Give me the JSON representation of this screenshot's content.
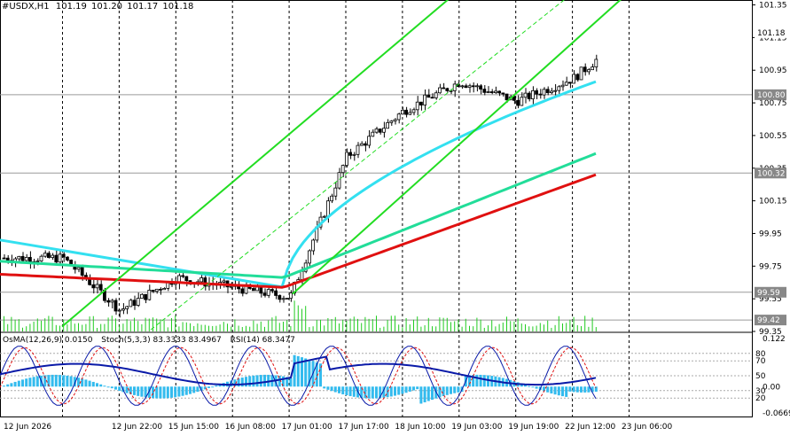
{
  "header": {
    "symbol": "#USDX,H1",
    "open": "101.19",
    "high": "101.20",
    "low": "101.17",
    "close": "101.18"
  },
  "indicators": {
    "osma": "OsMA(12,26,9) 0.0150",
    "stoch": "Stoch(5,3,3) 83.3333 83.4967",
    "rsi": "RSI(14) 68.3477"
  },
  "colors": {
    "background": "#ffffff",
    "bull_candle": "#000000",
    "bear_candle": "#000000",
    "ma_fast": "#33e0f0",
    "ma_mid": "#22dd99",
    "ma_slow": "#e01010",
    "channel": "#22dd22",
    "osma_hist": "#33bbee",
    "rsi_line": "#0a1aa8",
    "stoch_main": "#0a1aa8",
    "stoch_signal": "#e01010",
    "grid": "#000000",
    "price_tag": "#888888"
  },
  "chart_data": {
    "type": "candlestick",
    "title": "#USDX,H1",
    "ylim": [
      99.35,
      101.38
    ],
    "y_ticks": [
      "101.35",
      "101.15",
      "100.95",
      "100.75",
      "100.55",
      "100.35",
      "100.15",
      "99.95",
      "99.75",
      "99.55",
      "99.35"
    ],
    "x_ticks": [
      "12 Jun 2026",
      "12 Jun 22:00",
      "15 Jun 15:00",
      "16 Jun 08:00",
      "17 Jun 01:00",
      "17 Jun 17:00",
      "18 Jun 10:00",
      "19 Jun 03:00",
      "19 Jun 19:00",
      "22 Jun 12:00",
      "23 Jun 06:00"
    ],
    "price_levels": [
      {
        "label": "101.18",
        "value": 101.18,
        "style": "current"
      },
      {
        "label": "100.80",
        "value": 100.8,
        "style": "level"
      },
      {
        "label": "100.32",
        "value": 100.32,
        "style": "level"
      },
      {
        "label": "99.59",
        "value": 99.59,
        "style": "level"
      },
      {
        "label": "99.42",
        "value": 99.42,
        "style": "level"
      }
    ],
    "key_points": [
      {
        "x": "12 Jun 2026",
        "price": 99.8
      },
      {
        "x": "12 Jun 22:00",
        "price": 99.48
      },
      {
        "x": "15 Jun 15:00",
        "price": 99.68
      },
      {
        "x": "16 Jun 08:00",
        "price": 99.62
      },
      {
        "x": "17 Jun 01:00",
        "price": 99.56
      },
      {
        "x": "17 Jun 17:00",
        "price": 100.42
      },
      {
        "x": "18 Jun 10:00",
        "price": 100.7
      },
      {
        "x": "19 Jun 03:00",
        "price": 100.88
      },
      {
        "x": "19 Jun 19:00",
        "price": 100.76
      },
      {
        "x": "22 Jun 12:00",
        "price": 100.9
      },
      {
        "x": "23 Jun 06:00",
        "price": 101.18
      }
    ],
    "moving_averages": [
      {
        "start": 99.91,
        "end": 100.88
      },
      {
        "start": 99.78,
        "end": 100.44
      },
      {
        "start": 99.7,
        "end": 100.31
      }
    ],
    "indicator_panel": {
      "ylim": [
        -0.0669,
        0.122
      ],
      "left_ticks": [
        "0.122",
        "0.00",
        "-0.0669"
      ],
      "right_ticks": [
        "80",
        "70",
        "50",
        "30",
        "20"
      ],
      "osma_value": 0.015,
      "stoch_main": 83.3333,
      "stoch_signal": 83.4967,
      "rsi": 68.3477
    }
  }
}
